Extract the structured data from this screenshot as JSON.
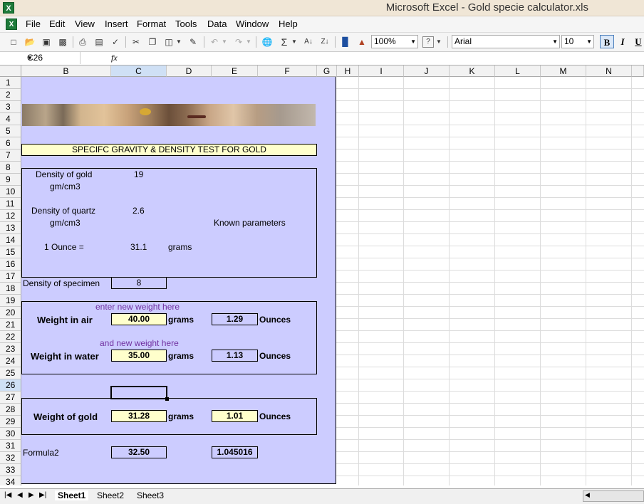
{
  "window": {
    "title": "Microsoft Excel - Gold specie calculator.xls",
    "app_icon_glyph": "X"
  },
  "menu": [
    "File",
    "Edit",
    "View",
    "Insert",
    "Format",
    "Tools",
    "Data",
    "Window",
    "Help"
  ],
  "toolbar": {
    "zoom": "100%",
    "font": "Arial",
    "size": "10",
    "bold": "B",
    "italic": "I",
    "underline": "U"
  },
  "formula_bar": {
    "name_box": "C26",
    "fx": "fx",
    "content": ""
  },
  "columns": [
    "B",
    "C",
    "D",
    "E",
    "F",
    "G",
    "H",
    "I",
    "J",
    "K",
    "L",
    "M",
    "N"
  ],
  "rows": [
    "1",
    "2",
    "3",
    "4",
    "5",
    "6",
    "7",
    "8",
    "9",
    "10",
    "11",
    "12",
    "13",
    "14",
    "15",
    "16",
    "17",
    "18",
    "19",
    "20",
    "21",
    "22",
    "23",
    "24",
    "25",
    "26",
    "27",
    "28",
    "29",
    "30",
    "31",
    "32",
    "33",
    "34"
  ],
  "sheet": {
    "title": "SPECIFC GRAVITY & DENSITY TEST FOR GOLD",
    "density_gold_label": "Density of gold",
    "density_gold_unit": "gm/cm3",
    "density_gold_value": "19",
    "density_quartz_label": "Density of quartz",
    "density_quartz_unit": "gm/cm3",
    "density_quartz_value": "2.6",
    "known_parameters": "Known parameters",
    "ounce_label": "1 Ounce  =",
    "ounce_value": "31.1",
    "ounce_unit": "grams",
    "specimen_label": "Density of specimen",
    "specimen_value": "8",
    "hint_air": "enter new weight here",
    "air_label": "Weight in air",
    "air_grams": "40.00",
    "air_ounces": "1.29",
    "hint_water": "and new weight here",
    "water_label": "Weight in water",
    "water_grams": "35.00",
    "water_ounces": "1.13",
    "gold_label": "Weight of gold",
    "gold_grams": "31.28",
    "gold_ounces": "1.01",
    "grams": "grams",
    "ounces": "Ounces",
    "formula_label": "Formula2",
    "formula_c": "32.50",
    "formula_e": "1.045016"
  },
  "tabs": [
    "Sheet1",
    "Sheet2",
    "Sheet3"
  ],
  "active_tab": "Sheet1",
  "colors": {
    "sheet_bg": "#ccccff",
    "input_bg": "#ffffcc",
    "hint": "#7030a0",
    "selected_header": "#cfe0f5"
  }
}
